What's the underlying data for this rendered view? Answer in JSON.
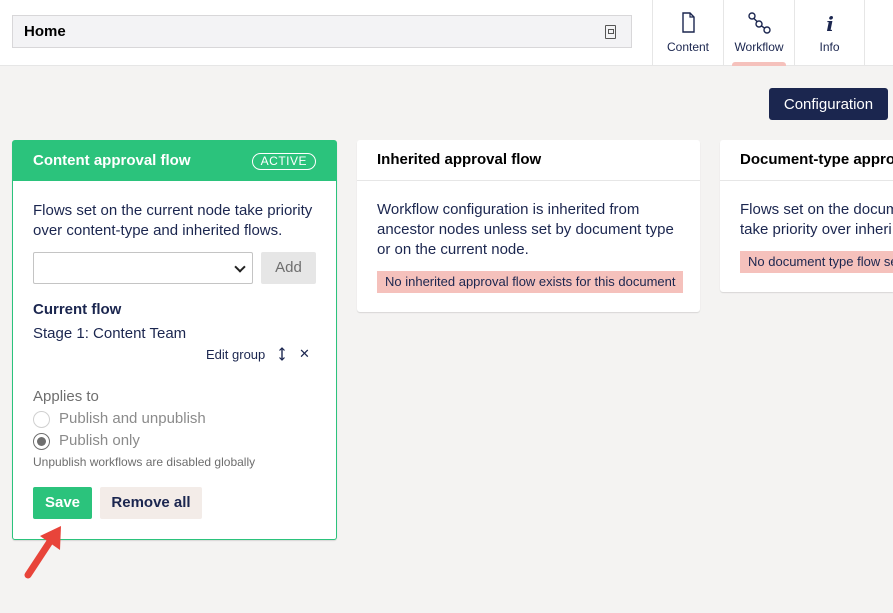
{
  "header": {
    "node_name": "Home",
    "tabs": [
      {
        "label": "Content",
        "icon": "document-icon"
      },
      {
        "label": "Workflow",
        "icon": "workflow-icon",
        "active": true
      },
      {
        "label": "Info",
        "icon": "info-icon"
      }
    ]
  },
  "toolbar": {
    "configuration_label": "Configuration"
  },
  "content_flow": {
    "title": "Content approval flow",
    "badge": "ACTIVE",
    "description": "Flows set on the current node take priority over content-type and inherited flows.",
    "select_value": "",
    "add_label": "Add",
    "current_flow_title": "Current flow",
    "stage": "Stage 1: Content Team",
    "edit_group_label": "Edit group",
    "applies_to_title": "Applies to",
    "options": [
      {
        "label": "Publish and unpublish",
        "checked": false
      },
      {
        "label": "Publish only",
        "checked": true
      }
    ],
    "hint": "Unpublish workflows are disabled globally",
    "save_label": "Save",
    "remove_all_label": "Remove all"
  },
  "inherited_flow": {
    "title": "Inherited approval flow",
    "description": "Workflow configuration is inherited from ancestor nodes unless set by document type or on the current node.",
    "alert": "No inherited approval flow exists for this document"
  },
  "doctype_flow": {
    "title": "Document-type approv",
    "description_line1": "Flows set on the docum",
    "description_line2": "take priority over inheri",
    "alert": "No document type flow se"
  },
  "colors": {
    "primary": "#1b264f",
    "success": "#2bc37c",
    "alert_bg": "#f5c1bc",
    "annotation_arrow": "#e8443a"
  }
}
